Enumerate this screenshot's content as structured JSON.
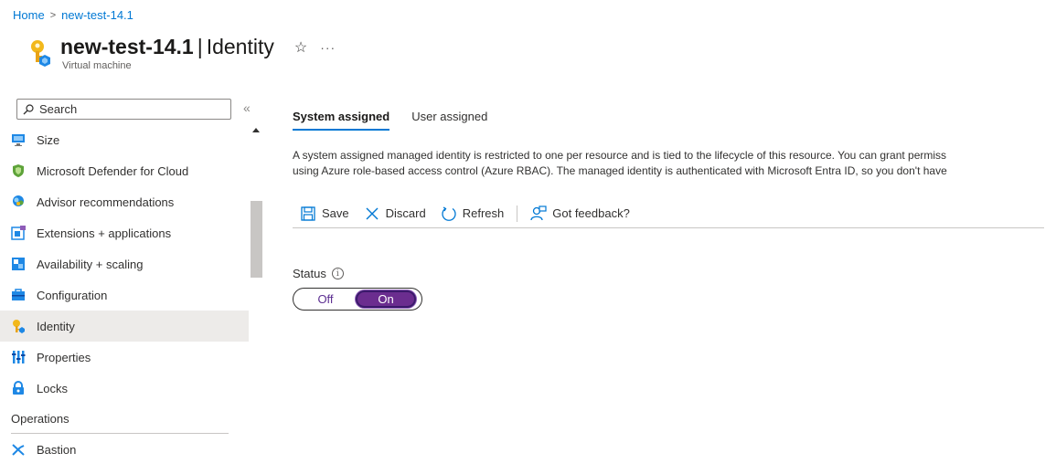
{
  "breadcrumb": {
    "home": "Home",
    "separator": ">",
    "current": "new-test-14.1"
  },
  "header": {
    "resource_name": "new-test-14.1",
    "separator": "|",
    "section": "Identity",
    "subtitle": "Virtual machine",
    "star_icon": "star-icon",
    "more_icon": "ellipsis-icon"
  },
  "sidebar": {
    "search_placeholder": "Search",
    "collapse_glyph": "«",
    "items": [
      {
        "label": "Size",
        "icon": "size-icon"
      },
      {
        "label": "Microsoft Defender for Cloud",
        "icon": "shield-icon"
      },
      {
        "label": "Advisor recommendations",
        "icon": "advisor-icon"
      },
      {
        "label": "Extensions + applications",
        "icon": "extensions-icon"
      },
      {
        "label": "Availability + scaling",
        "icon": "availability-icon"
      },
      {
        "label": "Configuration",
        "icon": "configuration-icon"
      },
      {
        "label": "Identity",
        "icon": "key-icon",
        "active": true
      },
      {
        "label": "Properties",
        "icon": "properties-icon"
      },
      {
        "label": "Locks",
        "icon": "lock-icon"
      }
    ],
    "section_operations": "Operations",
    "operations_items": [
      {
        "label": "Bastion",
        "icon": "bastion-icon"
      }
    ]
  },
  "tabs": [
    {
      "label": "System assigned",
      "active": true
    },
    {
      "label": "User assigned",
      "active": false
    }
  ],
  "description": {
    "line1": "A system assigned managed identity is restricted to one per resource and is tied to the lifecycle of this resource. You can grant permiss",
    "line2": "using Azure role-based access control (Azure RBAC). The managed identity is authenticated with Microsoft Entra ID, so you don't have"
  },
  "toolbar": {
    "save": "Save",
    "discard": "Discard",
    "refresh": "Refresh",
    "feedback": "Got feedback?"
  },
  "status": {
    "label": "Status",
    "info_glyph": "i",
    "off_label": "Off",
    "on_label": "On",
    "value": "On"
  },
  "colors": {
    "accent": "#0078d4",
    "toggle_on": "#6b2d8f",
    "active_nav_bg": "#edebe9"
  }
}
